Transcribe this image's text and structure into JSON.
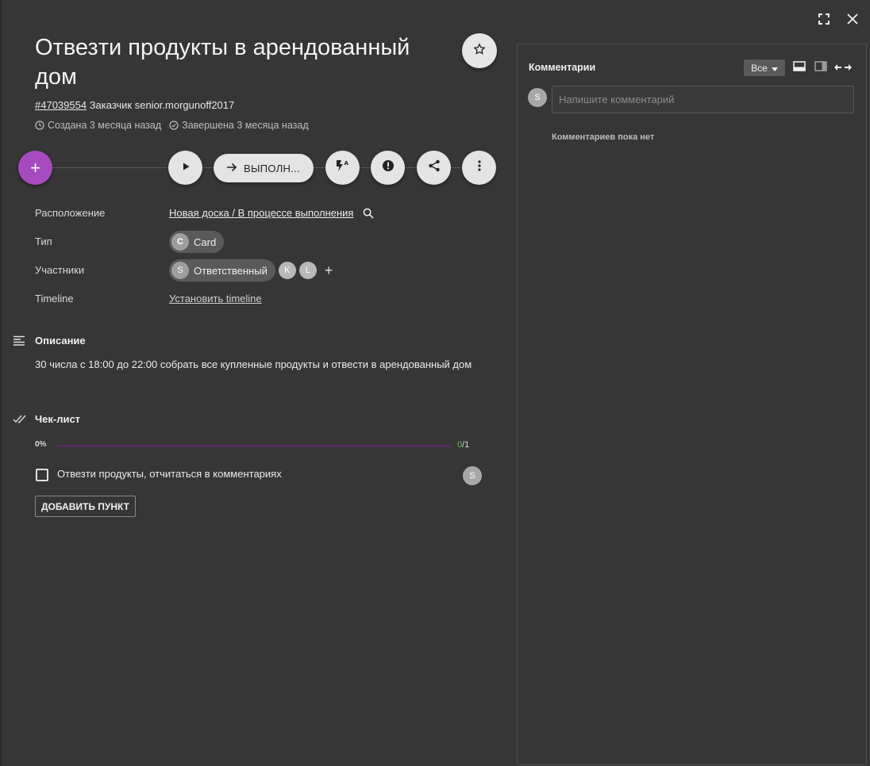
{
  "window": {
    "fullscreen_icon": "fullscreen-icon",
    "close_icon": "close-icon"
  },
  "task": {
    "title": "Отвезти продукты в арендованный дом",
    "id": "#47039554",
    "customer_label": "Заказчик",
    "customer": "senior.morgunoff2017",
    "created": "Создана 3 месяца назад",
    "completed": "Завершена 3 месяца назад"
  },
  "actions": {
    "add": "+",
    "status_label": "ВЫПОЛН...",
    "icons": [
      "play-icon",
      "arrow-right-icon",
      "auto-flash-icon",
      "alert-icon",
      "share-icon",
      "more-vert-icon"
    ]
  },
  "props": {
    "location_label": "Расположение",
    "location_value": "Новая доска / В процессе выполнения",
    "type_label": "Тип",
    "type_avatar": "C",
    "type_value": "Card",
    "members_label": "Участники",
    "responsible_avatar": "S",
    "responsible": "Ответственный",
    "member_k": "K",
    "member_l": "L",
    "add_member": "+",
    "timeline_label": "Timeline",
    "timeline_value": "Установить timeline"
  },
  "description": {
    "title": "Описание",
    "text": "30 числа с 18:00 до 22:00 собрать все купленные продукты и отвести в арендованный дом"
  },
  "checklist": {
    "title": "Чек-лист",
    "percent": "0%",
    "progress_fraction": 0,
    "done": "0",
    "total": "/1",
    "items": [
      {
        "label": "Отвезти продукты, отчитаться в комментариях",
        "checked": false,
        "avatar": "S"
      }
    ],
    "add_button": "ДОБАВИТЬ ПУНКТ"
  },
  "comments": {
    "title": "Комментарии",
    "filter": "Все",
    "avatar": "S",
    "placeholder": "Напишите комментарий",
    "empty": "Комментариев пока нет"
  },
  "colors": {
    "background": "#363636",
    "accent": "#a64bbf",
    "progress_track": "#542a63",
    "done_count": "#6dbb61"
  }
}
